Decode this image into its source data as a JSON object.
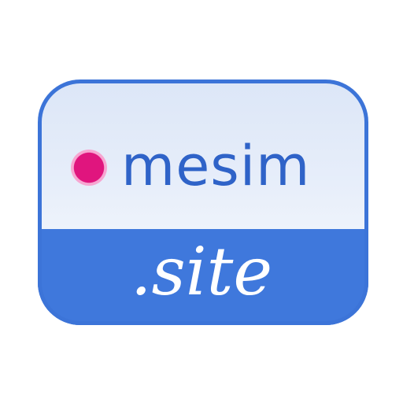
{
  "logo": {
    "name": "mesim",
    "tld": ".site",
    "dot_icon": "dot-icon"
  },
  "colors": {
    "top_panel": "#dfe9f8",
    "bottom_panel": "#3f78dc",
    "border": "#3c74d8",
    "name_text": "#2f63c8",
    "tld_text": "#ffffff",
    "dot": "#e0157e",
    "dot_halo": "#f7a6d1"
  }
}
